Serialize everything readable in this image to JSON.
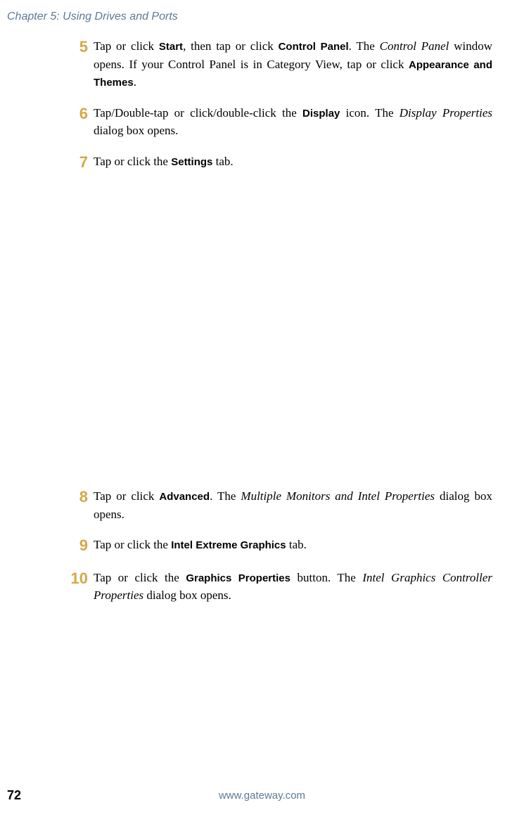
{
  "chapter_header": "Chapter 5: Using Drives and Ports",
  "steps": {
    "5": {
      "parts": [
        {
          "text": "Tap or click ",
          "type": "normal"
        },
        {
          "text": "Start",
          "type": "bold"
        },
        {
          "text": ", then tap or click ",
          "type": "normal"
        },
        {
          "text": "Control Panel",
          "type": "bold"
        },
        {
          "text": ". The ",
          "type": "normal"
        },
        {
          "text": "Control Panel",
          "type": "italic"
        },
        {
          "text": " window opens. If your Control Panel is in Category View, tap or click ",
          "type": "normal"
        },
        {
          "text": "Appearance and Themes",
          "type": "bold"
        },
        {
          "text": ".",
          "type": "normal"
        }
      ]
    },
    "6": {
      "parts": [
        {
          "text": "Tap/Double-tap or click/double-click the ",
          "type": "normal"
        },
        {
          "text": "Display",
          "type": "bold"
        },
        {
          "text": " icon. The ",
          "type": "normal"
        },
        {
          "text": "Display Properties",
          "type": "italic"
        },
        {
          "text": " dialog box opens.",
          "type": "normal"
        }
      ]
    },
    "7": {
      "parts": [
        {
          "text": "Tap or click the ",
          "type": "normal"
        },
        {
          "text": "Settings",
          "type": "bold"
        },
        {
          "text": " tab.",
          "type": "normal"
        }
      ]
    },
    "8": {
      "parts": [
        {
          "text": "Tap or click ",
          "type": "normal"
        },
        {
          "text": "Advanced",
          "type": "bold"
        },
        {
          "text": ". The ",
          "type": "normal"
        },
        {
          "text": "Multiple Monitors and Intel Properties",
          "type": "italic"
        },
        {
          "text": " dialog box opens.",
          "type": "normal"
        }
      ]
    },
    "9": {
      "parts": [
        {
          "text": "Tap or click the ",
          "type": "normal"
        },
        {
          "text": "Intel Extreme Graphics",
          "type": "bold"
        },
        {
          "text": " tab.",
          "type": "normal"
        }
      ]
    },
    "10": {
      "parts": [
        {
          "text": "Tap or click the ",
          "type": "normal"
        },
        {
          "text": "Graphics Properties",
          "type": "bold"
        },
        {
          "text": " button. The ",
          "type": "normal"
        },
        {
          "text": "Intel Graphics Controller Properties",
          "type": "italic"
        },
        {
          "text": " dialog box opens.",
          "type": "normal"
        }
      ]
    }
  },
  "footer": {
    "page_number": "72",
    "url": "www.gateway.com"
  }
}
